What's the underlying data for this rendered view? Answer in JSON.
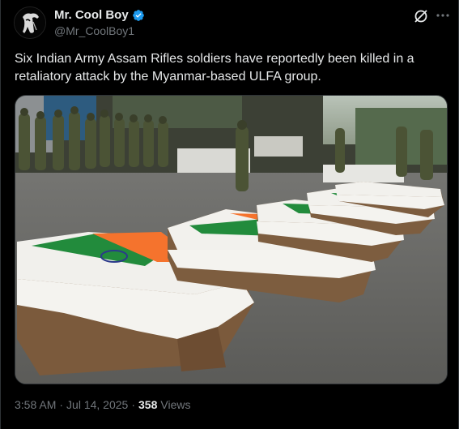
{
  "author": {
    "display_name": "Mr. Cool Boy",
    "handle": "@Mr_CoolBoy1",
    "verified": true
  },
  "tweet": {
    "text": "Six Indian Army Assam Rifles soldiers have reportedly been killed in a retaliatory attack by the Myanmar-based ULFA group."
  },
  "meta": {
    "time": "3:58 AM",
    "separator": "·",
    "date": "Jul 14, 2025",
    "views_count": "358",
    "views_label": "Views"
  },
  "icons": {
    "verified": "verified-badge-icon",
    "grok": "grok-icon",
    "more": "more-options-icon"
  },
  "colors": {
    "background": "#000000",
    "text": "#e7e9ea",
    "secondary_text": "#71767b",
    "verified_blue": "#1d9bf0",
    "border": "#2f3336"
  }
}
